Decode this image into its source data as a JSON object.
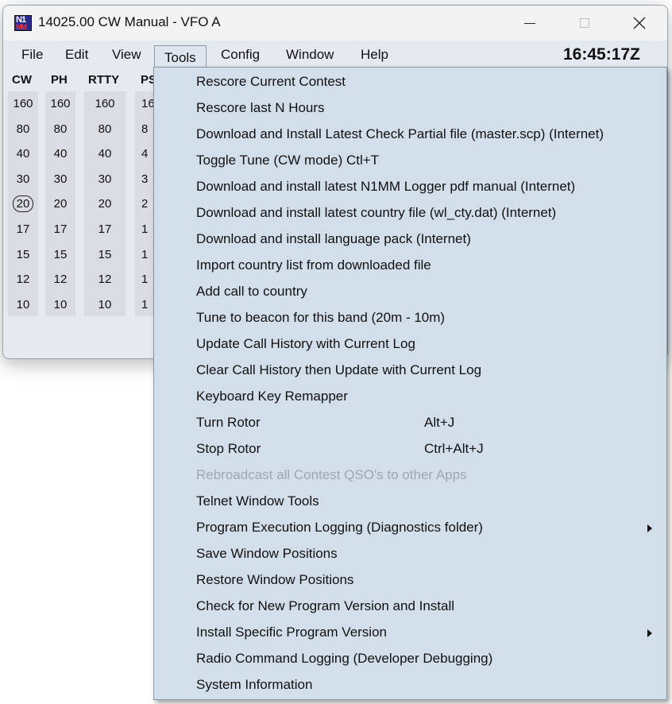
{
  "window": {
    "title": "14025.00 CW Manual - VFO A",
    "icon": {
      "name": "n1mm-logo-icon",
      "top_text": "N1",
      "bottom_text": "MM"
    },
    "controls": {
      "minimize": "minimize-icon",
      "maximize": "maximize-icon",
      "close": "close-icon"
    }
  },
  "menubar": {
    "items": [
      "File",
      "Edit",
      "View",
      "Tools",
      "Config",
      "Window",
      "Help"
    ],
    "active": "Tools"
  },
  "clock": "16:45:17Z",
  "bands": {
    "modes": [
      "CW",
      "PH",
      "RTTY",
      "PS"
    ],
    "rows": [
      "160",
      "80",
      "40",
      "30",
      "20",
      "17",
      "15",
      "12",
      "10"
    ],
    "visible_psk_partial": [
      "16",
      "8",
      "4",
      "3",
      "2",
      "1",
      "1",
      "1",
      "1"
    ],
    "selected": {
      "mode": "CW",
      "band": "20"
    }
  },
  "tools_menu": {
    "items": [
      {
        "label": "Rescore Current Contest"
      },
      {
        "label": "Rescore last N Hours"
      },
      {
        "label": "Download and Install Latest Check Partial file (master.scp) (Internet)"
      },
      {
        "label": "Toggle Tune (CW mode)  Ctl+T"
      },
      {
        "label": "Download and install latest N1MM Logger pdf manual (Internet)"
      },
      {
        "label": "Download and install latest country file (wl_cty.dat) (Internet)"
      },
      {
        "label": "Download and install language pack (Internet)"
      },
      {
        "label": "Import country list from downloaded file"
      },
      {
        "label": "Add call to country"
      },
      {
        "label": "Tune to beacon for this band  (20m - 10m)"
      },
      {
        "label": "Update Call History with Current Log"
      },
      {
        "label": "Clear Call History then Update with Current Log"
      },
      {
        "label": "Keyboard Key Remapper"
      },
      {
        "label": "Turn Rotor",
        "shortcut": "Alt+J"
      },
      {
        "label": "Stop Rotor",
        "shortcut": "Ctrl+Alt+J"
      },
      {
        "label": "Rebroadcast all Contest QSO's to other Apps",
        "disabled": true
      },
      {
        "label": "Telnet Window Tools"
      },
      {
        "label": "Program Execution Logging (Diagnostics folder)",
        "submenu": true
      },
      {
        "label": "Save Window Positions"
      },
      {
        "label": "Restore Window Positions"
      },
      {
        "label": "Check for New Program Version and Install"
      },
      {
        "label": "Install Specific Program Version",
        "submenu": true
      },
      {
        "label": "Radio Command Logging  (Developer Debugging)"
      },
      {
        "label": "System Information"
      }
    ]
  }
}
